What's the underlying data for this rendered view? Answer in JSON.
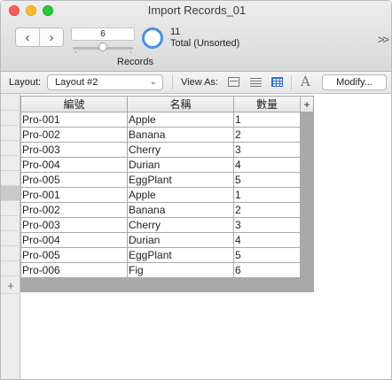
{
  "window": {
    "title": "Import Records_01"
  },
  "toolbar": {
    "back_icon": "‹",
    "forward_icon": "›",
    "current_record": "6",
    "records_label": "Records",
    "found_count": "11",
    "found_status": "Total (Unsorted)",
    "overflow_icon": ">>"
  },
  "layoutbar": {
    "layout_label": "Layout:",
    "layout_value": "Layout #2",
    "view_as_label": "View As:",
    "font_size_icon": "A",
    "modify_label": "Modify..."
  },
  "table": {
    "add_column_icon": "+",
    "add_record_icon": "+",
    "columns": [
      "編號",
      "名稱",
      "數量"
    ],
    "rows": [
      [
        "Pro-001",
        "Apple",
        "1"
      ],
      [
        "Pro-002",
        "Banana",
        "2"
      ],
      [
        "Pro-003",
        "Cherry",
        "3"
      ],
      [
        "Pro-004",
        "Durian",
        "4"
      ],
      [
        "Pro-005",
        "EggPlant",
        "5"
      ],
      [
        "Pro-001",
        "Apple",
        "1"
      ],
      [
        "Pro-002",
        "Banana",
        "2"
      ],
      [
        "Pro-003",
        "Cherry",
        "3"
      ],
      [
        "Pro-004",
        "Durian",
        "4"
      ],
      [
        "Pro-005",
        "EggPlant",
        "5"
      ],
      [
        "Pro-006",
        "Fig",
        "6"
      ]
    ],
    "selected_row_index": 5
  },
  "colors": {
    "accent": "#2f6fd6",
    "pie": "#4a8fe6",
    "close": "#fc5f57",
    "minimize": "#fdbc2e",
    "maximize": "#28c840"
  }
}
